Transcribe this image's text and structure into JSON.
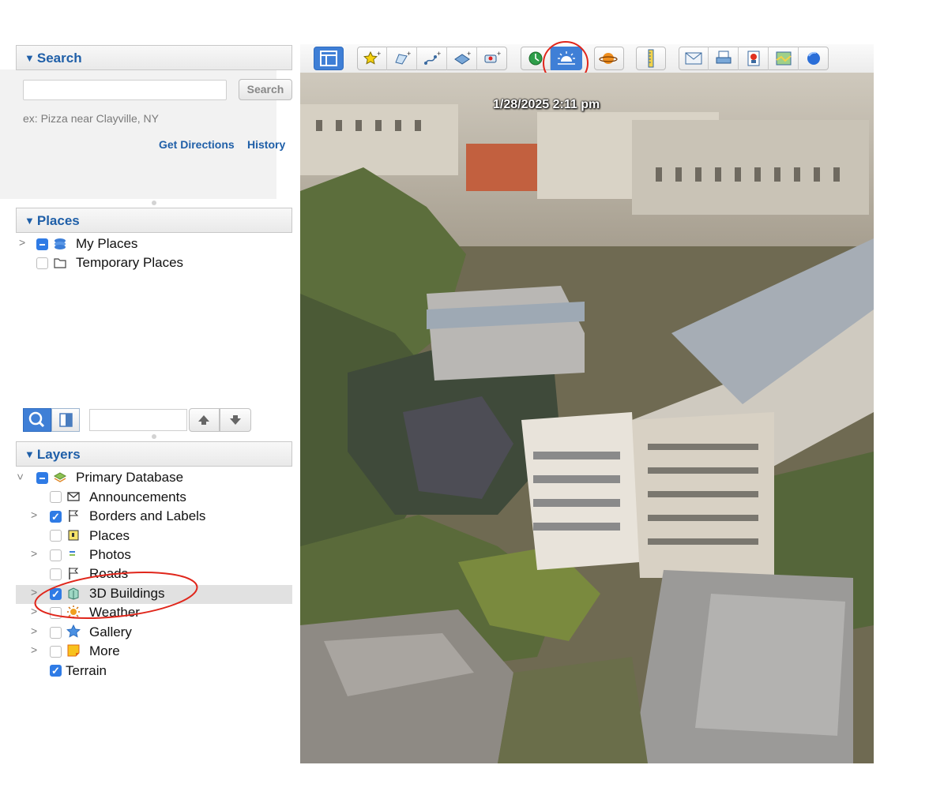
{
  "search": {
    "header": "Search",
    "input_value": "",
    "button_label": "Search",
    "hint": "ex: Pizza near Clayville, NY",
    "get_directions": "Get Directions",
    "history": "History"
  },
  "places": {
    "header": "Places",
    "items": [
      {
        "label": "My Places",
        "icon": "globe-stack-icon",
        "state": "mixed",
        "expandable": true
      },
      {
        "label": "Temporary Places",
        "icon": "folder-icon",
        "state": "unchecked",
        "expandable": false
      }
    ]
  },
  "layers": {
    "header": "Layers",
    "root": {
      "label": "Primary Database",
      "icon": "layers-stack-icon",
      "state": "mixed",
      "expanded": true
    },
    "items": [
      {
        "label": "Announcements",
        "icon": "envelope-icon",
        "checked": false,
        "expandable": false
      },
      {
        "label": "Borders and Labels",
        "icon": "flag-icon",
        "checked": true,
        "expandable": true
      },
      {
        "label": "Places",
        "icon": "place-square-icon",
        "checked": false,
        "expandable": false
      },
      {
        "label": "Photos",
        "icon": "photo-icon",
        "checked": false,
        "expandable": true
      },
      {
        "label": "Roads",
        "icon": "road-flag-icon",
        "checked": false,
        "expandable": false
      },
      {
        "label": "3D Buildings",
        "icon": "building-icon",
        "checked": true,
        "expandable": true,
        "selected": true
      },
      {
        "label": "Weather",
        "icon": "sun-icon",
        "checked": false,
        "expandable": true
      },
      {
        "label": "Gallery",
        "icon": "star-icon",
        "checked": false,
        "expandable": true
      },
      {
        "label": "More",
        "icon": "sticky-note-icon",
        "checked": false,
        "expandable": true
      }
    ],
    "terrain": {
      "label": "Terrain",
      "checked": true
    }
  },
  "toolbar": {
    "buttons": [
      "sidebar-toggle-icon",
      "add-placemark-icon",
      "add-polygon-icon",
      "add-path-icon",
      "add-image-overlay-icon",
      "record-tour-icon",
      "historical-imagery-icon",
      "sunlight-icon",
      "planets-icon",
      "ruler-icon",
      "email-icon",
      "print-icon",
      "save-image-icon",
      "view-in-maps-icon",
      "earth-icon"
    ]
  },
  "map": {
    "timestamp": "1/28/2025  2:11 pm"
  },
  "colors": {
    "accent": "#1f5fa8",
    "checkbox": "#2f7be5",
    "annotation": "#e0261b"
  }
}
